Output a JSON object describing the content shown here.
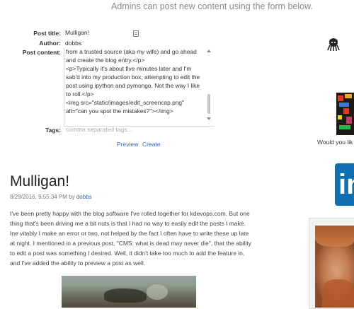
{
  "notice": "Admins can post new content using the form below.",
  "form": {
    "title_label": "Post title:",
    "title_value": "Mulligan!",
    "author_label": "Author:",
    "author_value": "dobbs",
    "content_label": "Post content:",
    "content_lines": [
      "from a trusted source (aka my wife) and go ahead",
      "and create the blog entry.</p>",
      "<p>Typically it's about five minutes later and I'm",
      "sab'd into my production box, attempting to edit the",
      "post using ipython and pymongo. Not the way I like",
      "to roll.</p>",
      "<img src=\"static/images/edit_screencap.png\"",
      "alt=\"can you spot the mistakes?\"></img>"
    ],
    "tags_label": "Tags:",
    "tags_placeholder": "comma separated tags...",
    "preview_label": "Preview",
    "create_label": "Create"
  },
  "post": {
    "title": "Mulligan!",
    "date": "8/29/2016, 9:55:34 PM by",
    "author": "dobbs",
    "body": "I've been pretty happy with the blog software I've rolled together for kdevops.com. But one thing that's been driving me a bit nuts is that I had no way to easily edit the posts I make. Ine vitably I make an error or two, not helped by the fact I often have to write these up late at night. I mentioned in a previous post, \"CMS: what is dead may never die\", that the ability to edit a post was something I desired. Well, it didn't take too much to add the feature in, and I've added the ability to preview a post as well."
  },
  "sidebar": {
    "caption": "Would you lik",
    "linkedin_glyph": "in",
    "icons": [
      "github-octocat-icon",
      "pixel-art-image",
      "linkedin-icon",
      "avatar-photo"
    ]
  },
  "colors": {
    "link": "#2a6ab5",
    "linkedin": "#0f6fb0",
    "notice": "#8a8a8a"
  }
}
